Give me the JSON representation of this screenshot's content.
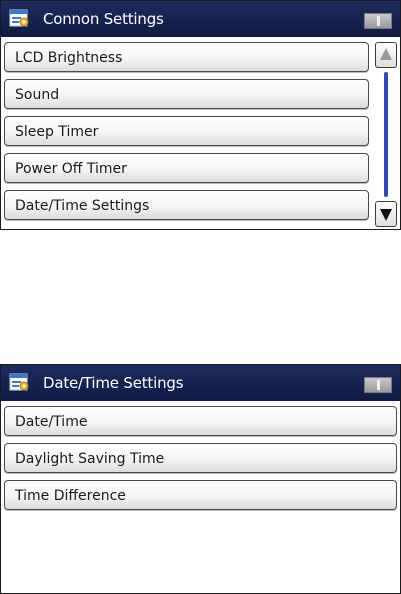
{
  "screens": [
    {
      "title": "Connon Settings",
      "menu_items": [
        "LCD Brightness",
        "Sound",
        "Sleep Timer",
        "Power Off Timer",
        "Date/Time Settings"
      ],
      "has_scrollbar": true
    },
    {
      "title": "Date/Time Settings",
      "menu_items": [
        "Date/Time",
        "Daylight Saving Time",
        "Time Difference"
      ],
      "has_scrollbar": false
    }
  ],
  "icons": {
    "title": "settings-icon",
    "status": "status-indicator-icon",
    "scroll_up": "scroll-up-arrow-icon",
    "scroll_down": "scroll-down-arrow-icon"
  },
  "colors": {
    "titlebar": "#152452",
    "scroll_thumb": "#2e47c8"
  }
}
